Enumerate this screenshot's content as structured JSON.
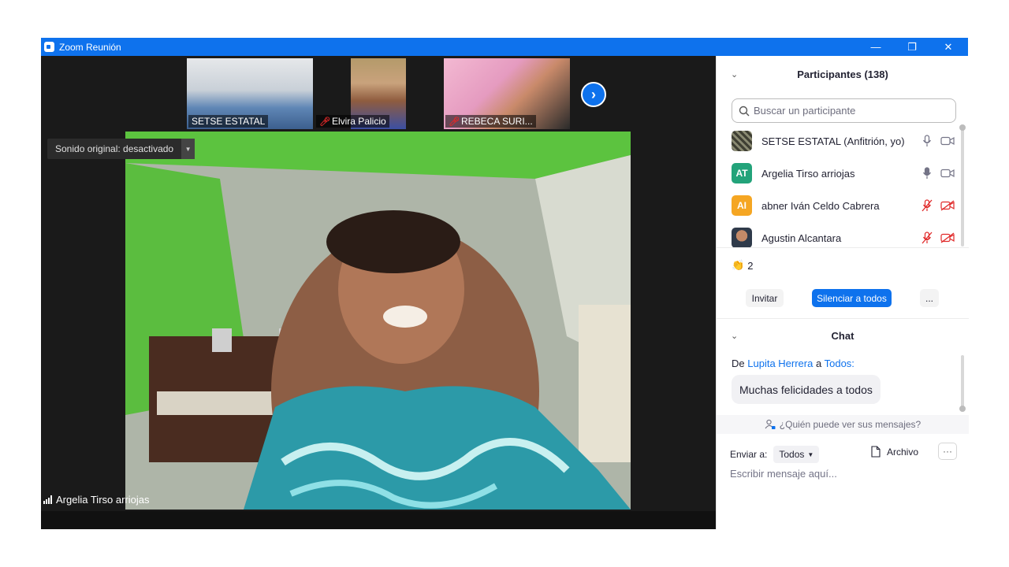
{
  "window": {
    "title": "Zoom Reunión",
    "minimize": "—",
    "restore": "❐",
    "close": "✕"
  },
  "gallery": {
    "thumbnails": [
      {
        "name": "SETSE ESTATAL",
        "muted": false
      },
      {
        "name": "Elvira Palicio",
        "muted": true
      },
      {
        "name": "REBECA SURI...",
        "muted": true
      }
    ],
    "next_icon": "chevron-right-icon"
  },
  "main_video": {
    "sound_label": "Sonido original: desactivado",
    "speaker_name": "Argelia Tirso arriojas"
  },
  "participants": {
    "title": "Participantes (138)",
    "search_placeholder": "Buscar un participante",
    "list": [
      {
        "name": "SETSE ESTATAL (Anfitrión, yo)",
        "initials": "",
        "avatar_color": "#5a5a4a",
        "mic": "on",
        "video": "on"
      },
      {
        "name": "Argelia Tirso arriojas",
        "initials": "AT",
        "avatar_color": "#23a37a",
        "mic": "on",
        "video": "on"
      },
      {
        "name": "abner Iván Celdo Cabrera",
        "initials": "AI",
        "avatar_color": "#f5a623",
        "mic": "off",
        "video": "off"
      },
      {
        "name": "Agustin Alcantara",
        "initials": "",
        "avatar_color": "#b07a5a",
        "mic": "off",
        "video": "off"
      }
    ],
    "reaction_icon": "👏",
    "reaction_count": "2",
    "invite_label": "Invitar",
    "mute_all_label": "Silenciar a todos",
    "more_label": "..."
  },
  "chat": {
    "title": "Chat",
    "from_prefix": "De",
    "sender": "Lupita Herrera",
    "connector": "a",
    "recipient": "Todos:",
    "message": "Muchas felicidades a todos",
    "who_can_see": "¿Quién puede ver sus mensajes?",
    "send_to_label": "Enviar a:",
    "send_to_value": "Todos",
    "file_label": "Archivo",
    "more_label": "···",
    "input_placeholder": "Escribir mensaje aquí..."
  },
  "colors": {
    "accent": "#0e72ed",
    "muted_red": "#e02828"
  }
}
